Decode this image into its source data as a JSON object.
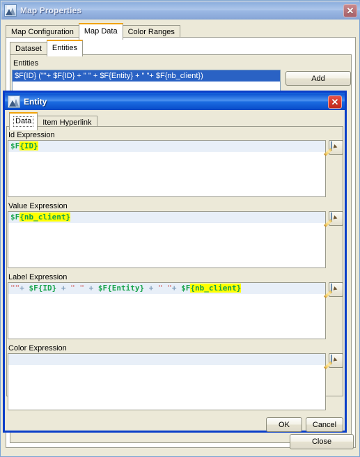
{
  "map_properties_window": {
    "title": "Map Properties",
    "icon": "map-properties-icon",
    "close_icon": "close-icon",
    "tabs": [
      {
        "label": "Map Configuration",
        "selected": false
      },
      {
        "label": "Map Data",
        "selected": true
      },
      {
        "label": "Color Ranges",
        "selected": false
      }
    ],
    "sub_tabs": [
      {
        "label": "Dataset",
        "selected": false
      },
      {
        "label": "Entities",
        "selected": true
      }
    ],
    "entities_group_label": "Entities",
    "entities_list": [
      {
        "text": "$F{ID} (\"\"+ $F{ID} + \" \" + $F{Entity} + \" \"+ $F{nb_client})",
        "selected": true
      }
    ],
    "add_button_label": "Add",
    "close_button_label": "Close"
  },
  "entity_dialog": {
    "title": "Entity",
    "icon": "entity-icon",
    "close_icon": "close-icon",
    "tabs": [
      {
        "label": "Data",
        "selected": true
      },
      {
        "label": "Item Hyperlink",
        "selected": false
      }
    ],
    "expressions": [
      {
        "name": "id-expression",
        "label": "Id Expression",
        "value": "$F{ID}",
        "tokens": [
          {
            "text": "$F",
            "type": "field"
          },
          {
            "text": "{ID}",
            "type": "field-highlight"
          }
        ]
      },
      {
        "name": "value-expression",
        "label": "Value Expression",
        "value": "$F{nb_client}",
        "tokens": [
          {
            "text": "$F",
            "type": "field"
          },
          {
            "text": "{nb_client}",
            "type": "field-highlight"
          }
        ]
      },
      {
        "name": "label-expression",
        "label": "Label Expression",
        "value": "\"\"+ $F{ID} + \" \" + $F{Entity} + \" \"+ $F{nb_client}",
        "tokens": [
          {
            "text": "\"\"",
            "type": "string"
          },
          {
            "text": "+ ",
            "type": "op"
          },
          {
            "text": "$F{ID}",
            "type": "field"
          },
          {
            "text": " + ",
            "type": "op"
          },
          {
            "text": "\" \"",
            "type": "string"
          },
          {
            "text": " + ",
            "type": "op"
          },
          {
            "text": "$F{Entity}",
            "type": "field"
          },
          {
            "text": " + ",
            "type": "op"
          },
          {
            "text": "\" \"",
            "type": "string"
          },
          {
            "text": "+ ",
            "type": "op"
          },
          {
            "text": "$F",
            "type": "field"
          },
          {
            "text": "{nb_client}",
            "type": "field-highlight"
          }
        ]
      },
      {
        "name": "color-expression",
        "label": "Color Expression",
        "value": "",
        "tokens": []
      }
    ],
    "edit_button_icon": "pencil-edit-icon",
    "ok_button_label": "OK",
    "cancel_button_label": "Cancel"
  },
  "colors": {
    "selection_blue": "#2a62c4",
    "dialog_border_blue": "#0a3ec8",
    "tab_accent_orange": "#f0a30a",
    "field_green": "#16a34a",
    "highlight_yellow": "#ffff00",
    "window_face": "#ece9d8"
  }
}
